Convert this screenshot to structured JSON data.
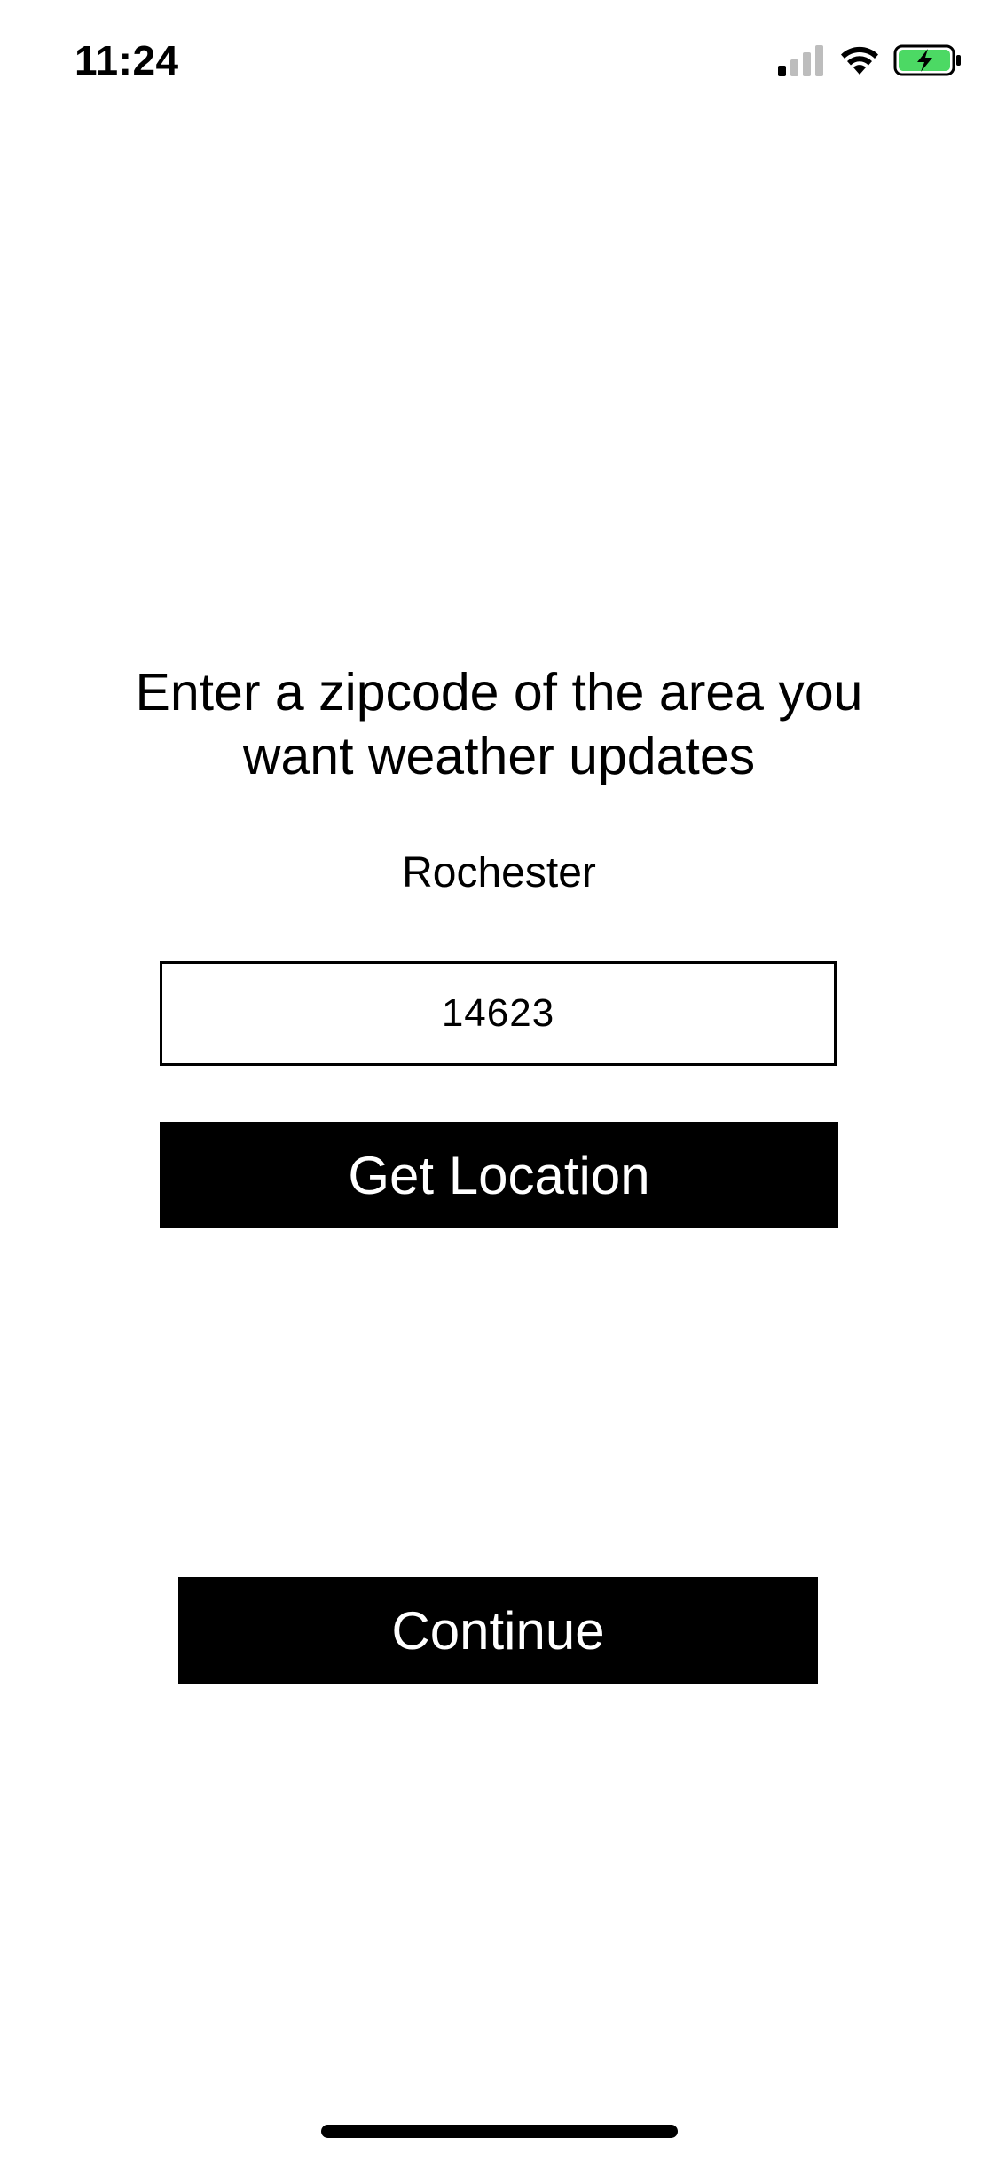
{
  "status_bar": {
    "time": "11:24",
    "icons": [
      "cellular-signal-icon",
      "wifi-icon",
      "battery-charging-icon"
    ],
    "battery_color": "#4cd964"
  },
  "main": {
    "prompt": "Enter a zipcode of the area you want weather updates",
    "city": "Rochester",
    "zip_value": "14623",
    "get_location_label": "Get Location",
    "continue_label": "Continue"
  }
}
